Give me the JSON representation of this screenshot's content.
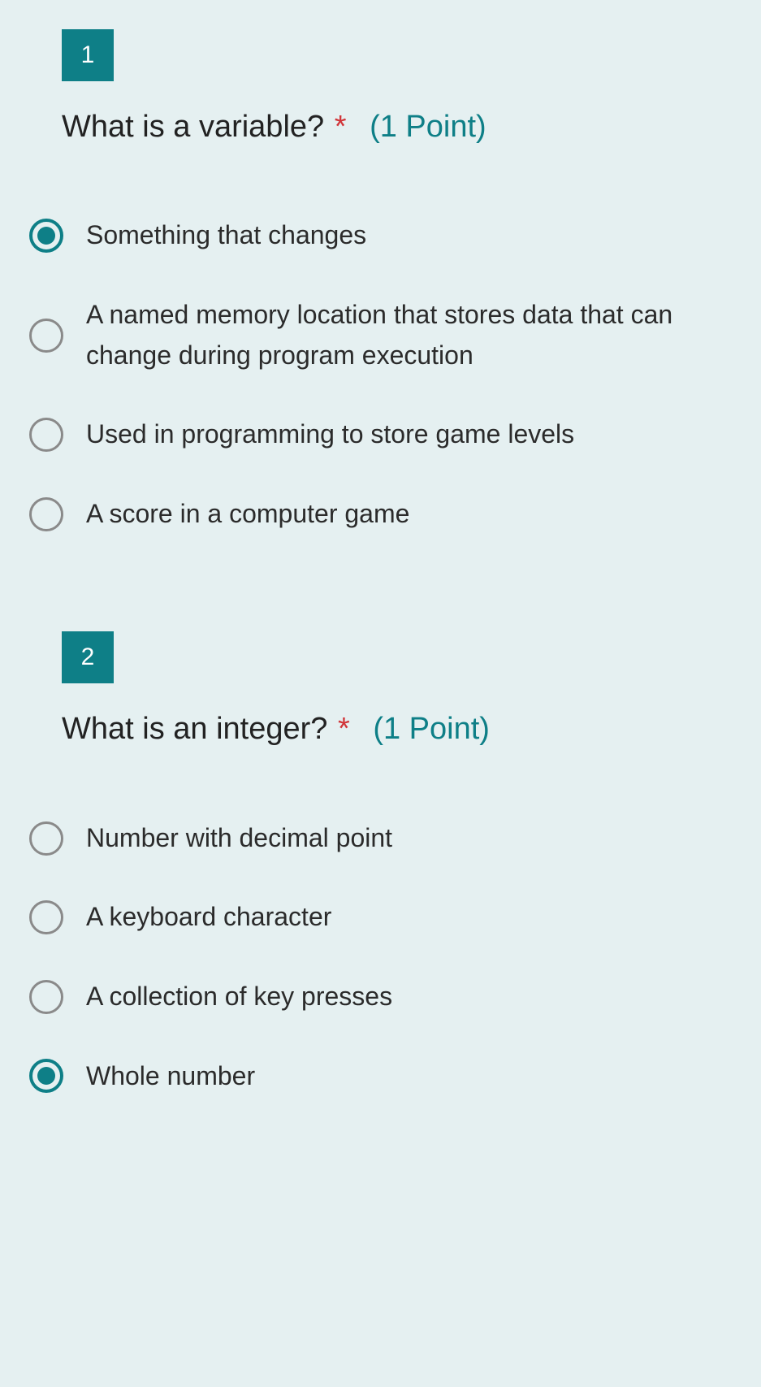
{
  "questions": [
    {
      "number": "1",
      "title": "What is a variable?",
      "required_marker": "*",
      "points_label": "(1 Point)",
      "options": [
        {
          "label": "Something that changes",
          "selected": true
        },
        {
          "label": "A named memory location that stores data that can change during program execution",
          "selected": false
        },
        {
          "label": "Used in programming to store game levels",
          "selected": false
        },
        {
          "label": "A score in a computer game",
          "selected": false
        }
      ]
    },
    {
      "number": "2",
      "title": "What is an integer?",
      "required_marker": "*",
      "points_label": "(1 Point)",
      "options": [
        {
          "label": "Number with decimal point",
          "selected": false
        },
        {
          "label": "A keyboard character",
          "selected": false
        },
        {
          "label": "A collection of key presses",
          "selected": false
        },
        {
          "label": "Whole number",
          "selected": true
        }
      ]
    }
  ],
  "colors": {
    "accent": "#0e7f87",
    "required": "#d13438",
    "page_bg": "#e5f0f1"
  }
}
